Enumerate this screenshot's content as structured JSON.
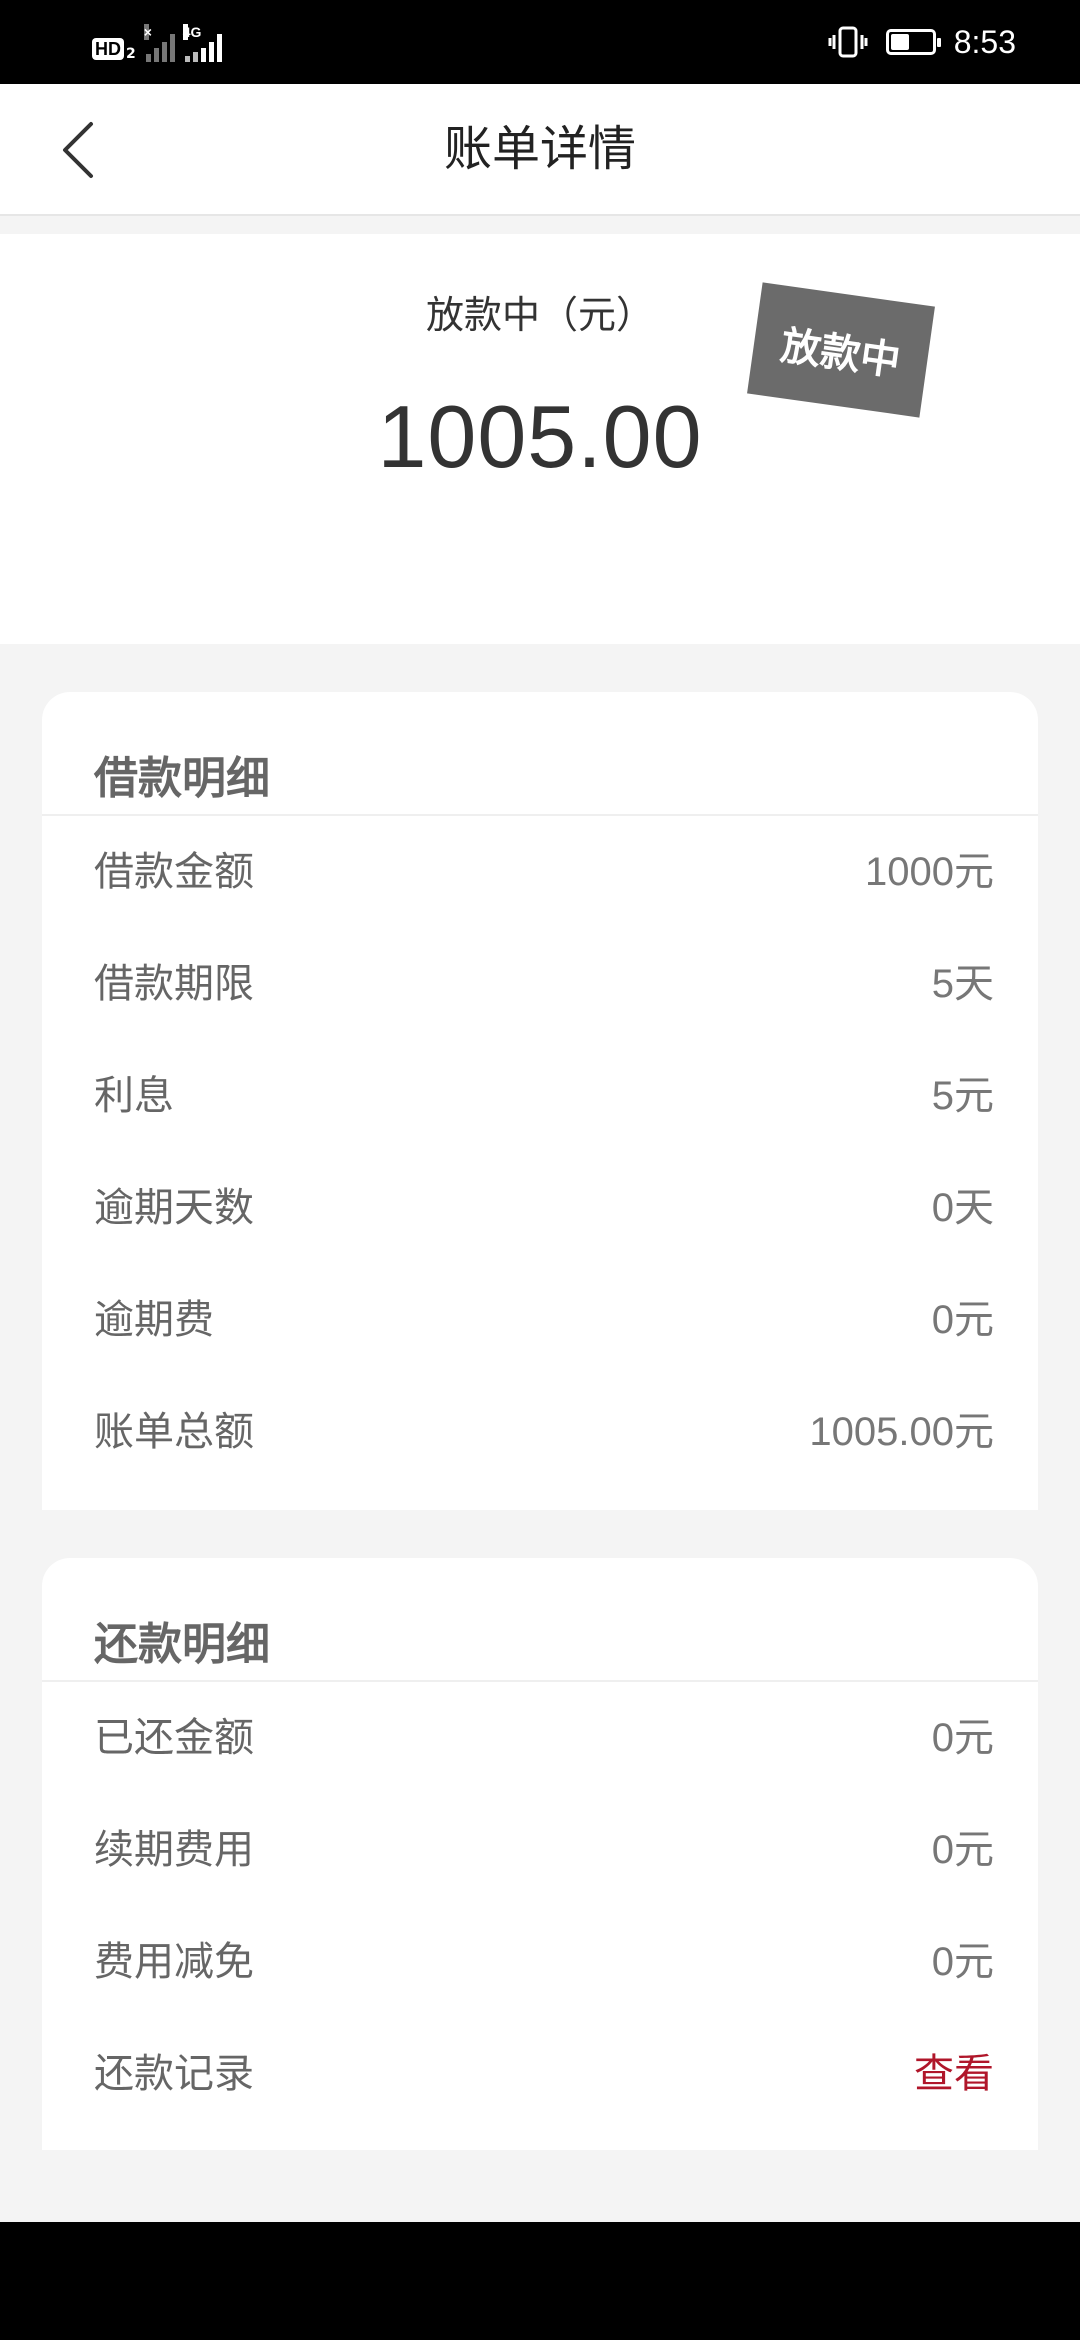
{
  "status_bar": {
    "hd_label": "HD",
    "hd_sub": "2",
    "net1_label": "×",
    "net2_label": "4G",
    "time": "8:53",
    "battery_level": 0.45,
    "icons": [
      "hd-icon",
      "signal-icon",
      "vibrate-icon",
      "battery-icon"
    ]
  },
  "nav": {
    "title": "账单详情",
    "back_icon": "chevron-left-icon"
  },
  "hero": {
    "label": "放款中（元）",
    "amount": "1005.00",
    "stamp": "放款中"
  },
  "loan_details": {
    "title": "借款明细",
    "rows": [
      {
        "label": "借款金额",
        "value": "1000元"
      },
      {
        "label": "借款期限",
        "value": "5天"
      },
      {
        "label": "利息",
        "value": "5元"
      },
      {
        "label": "逾期天数",
        "value": "0天"
      },
      {
        "label": "逾期费",
        "value": "0元"
      },
      {
        "label": "账单总额",
        "value": "1005.00元"
      }
    ]
  },
  "repay_details": {
    "title": "还款明细",
    "rows": [
      {
        "label": "已还金额",
        "value": "0元"
      },
      {
        "label": "续期费用",
        "value": "0元"
      },
      {
        "label": "费用减免",
        "value": "0元"
      }
    ],
    "record": {
      "label": "还款记录",
      "link": "查看"
    }
  },
  "colors": {
    "accent_link": "#b0162a",
    "stamp_bg": "#6b6b6b",
    "page_bg": "#f4f4f4"
  }
}
